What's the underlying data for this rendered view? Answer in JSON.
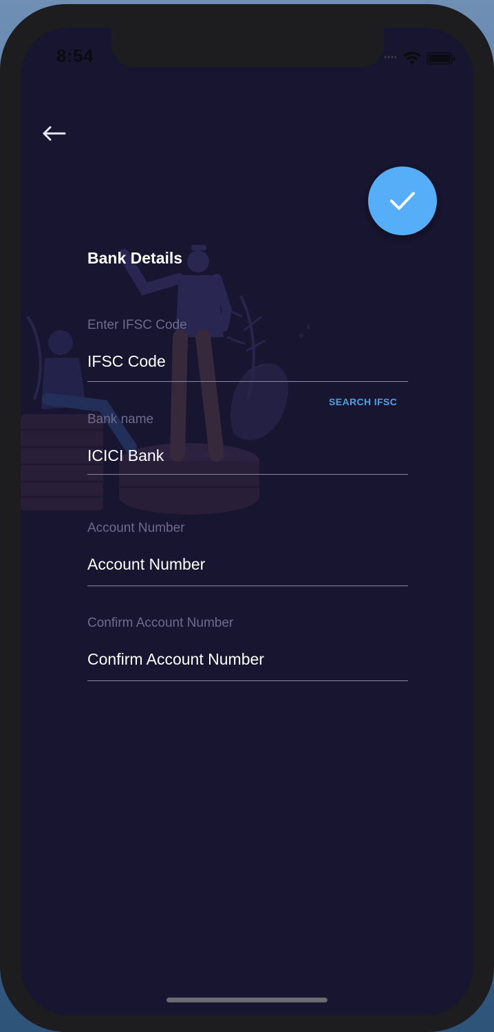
{
  "status_bar": {
    "time": "8:54"
  },
  "header": {
    "back_icon": "arrow-left-icon",
    "confirm_icon": "checkmark-icon"
  },
  "page": {
    "title": "Bank Details"
  },
  "form": {
    "ifsc": {
      "label": "Enter IFSC Code",
      "value": "IFSC Code"
    },
    "search_ifsc_label": "SEARCH IFSC",
    "bank_name": {
      "label": "Bank name",
      "value": "ICICI Bank"
    },
    "account_number": {
      "label": "Account Number",
      "value": "Account Number"
    },
    "confirm_account_number": {
      "label": "Confirm Account Number",
      "value": "Confirm Account Number"
    }
  },
  "colors": {
    "background": "#17152f",
    "accent": "#55aef7",
    "link": "#4da3e6"
  }
}
